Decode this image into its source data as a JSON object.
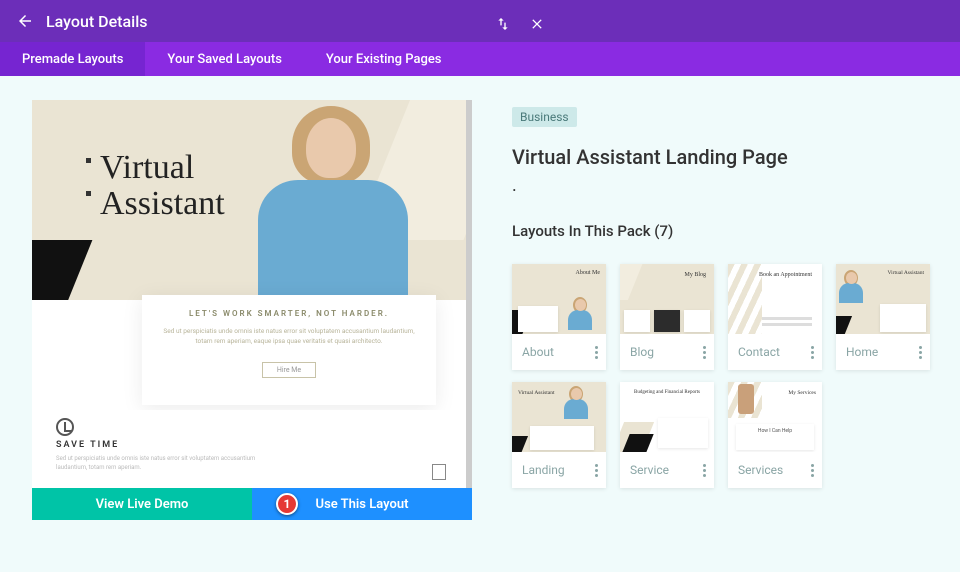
{
  "header": {
    "title": "Layout Details"
  },
  "tabs": [
    {
      "label": "Premade Layouts",
      "active": true
    },
    {
      "label": "Your Saved Layouts",
      "active": false
    },
    {
      "label": "Your Existing Pages",
      "active": false
    }
  ],
  "preview": {
    "hero_line1": "Virtual",
    "hero_line2": "Assistant",
    "tagline": "LET'S WORK SMARTER, NOT HARDER.",
    "lorem": "Sed ut perspiciatis unde omnis iste natus error sit voluptatem accusantium laudantium, totam rem aperiam, eaque ipsa quae veritatis et quasi architecto.",
    "cta": "Hire Me",
    "feature_title": "SAVE TIME",
    "feature_text": "Sed ut perspiciatis unde omnis iste natus error sit voluptatem accusantium laudantium, totam rem aperiam."
  },
  "actions": {
    "demo": "View Live Demo",
    "use": "Use This Layout",
    "marker": "1"
  },
  "sidebar": {
    "category": "Business",
    "title": "Virtual Assistant Landing Page",
    "pack_heading": "Layouts In This Pack (7)",
    "cards": [
      {
        "label": "About",
        "thumb_text": "About Me"
      },
      {
        "label": "Blog",
        "thumb_text": "My Blog"
      },
      {
        "label": "Contact",
        "thumb_text": "Book an Appointment"
      },
      {
        "label": "Home",
        "thumb_text": "Virtual Assistant"
      },
      {
        "label": "Landing",
        "thumb_text": "Virtual Assistant"
      },
      {
        "label": "Service",
        "thumb_text": "Budgeting and Financial Reports"
      },
      {
        "label": "Services",
        "thumb_text": "My Services"
      }
    ]
  }
}
